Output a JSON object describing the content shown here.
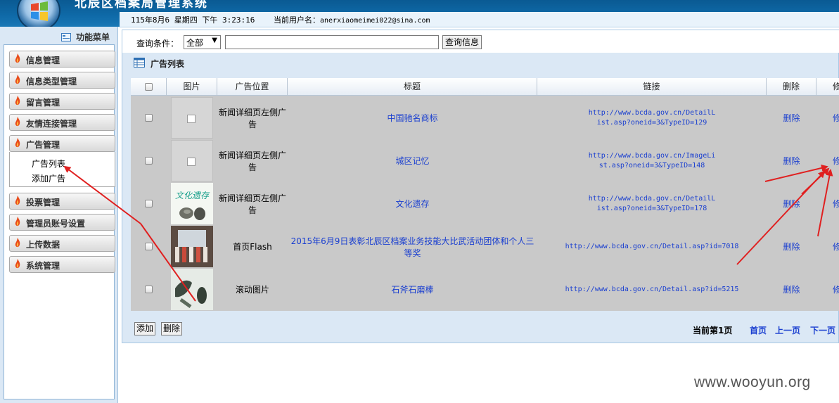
{
  "header": {
    "title": "北辰区档案局管理系统",
    "datetime": "115年8月6 星期四 下午 3:23:16",
    "user_label": "当前用户名：",
    "user_name": "anerxiaomeimei022@sina.com"
  },
  "sidebar": {
    "heading": "功能菜单",
    "items": [
      {
        "label": "信息管理"
      },
      {
        "label": "信息类型管理"
      },
      {
        "label": "留言管理"
      },
      {
        "label": "友情连接管理"
      },
      {
        "label": "广告管理"
      },
      {
        "label": "投票管理"
      },
      {
        "label": "管理员账号设置"
      },
      {
        "label": "上传数据"
      },
      {
        "label": "系统管理"
      }
    ],
    "submenu": [
      {
        "label": "广告列表"
      },
      {
        "label": "添加广告"
      }
    ]
  },
  "search": {
    "label": "查询条件：",
    "select_value": "全部",
    "input_value": "",
    "button": "查询信息"
  },
  "list": {
    "title": "广告列表",
    "columns": [
      "图片",
      "广告位置",
      "标题",
      "链接",
      "删除",
      "修"
    ],
    "rows": [
      {
        "position": "新闻详细页左侧广告",
        "title": "中国驰名商标",
        "link": "http://www.bcda.gov.cn/DetailList.asp?oneid=3&TypeID=129",
        "delete": "删除",
        "edit": "修"
      },
      {
        "position": "新闻详细页左侧广告",
        "title": "城区记忆",
        "link": "http://www.bcda.gov.cn/ImageList.asp?oneid=3&TypeID=148",
        "delete": "删除",
        "edit": "修"
      },
      {
        "position": "新闻详细页左侧广告",
        "title": "文化遗存",
        "link": "http://www.bcda.gov.cn/DetailList.asp?oneid=3&TypeID=178",
        "delete": "删除",
        "edit": "修"
      },
      {
        "position": "首页Flash",
        "title": "2015年6月9日表彰北辰区档案业务技能大比武活动团体和个人三等奖",
        "link": "http://www.bcda.gov.cn/Detail.asp?id=7018",
        "delete": "删除",
        "edit": "修"
      },
      {
        "position": "滚动图片",
        "title": "石斧石磨棒",
        "link": "http://www.bcda.gov.cn/Detail.asp?id=5215",
        "delete": "删除",
        "edit": "修"
      }
    ],
    "thumb_text": "文化遗存"
  },
  "footer": {
    "add_button": "添加",
    "delete_button": "删除",
    "page_info": "当前第1页",
    "first": "首页",
    "prev": "上一页",
    "next": "下一页"
  },
  "watermark": "www.wooyun.org",
  "colors": {
    "header": "#0f6aa8",
    "link": "#1a3fd0",
    "annotation_arrow": "#e02020"
  }
}
